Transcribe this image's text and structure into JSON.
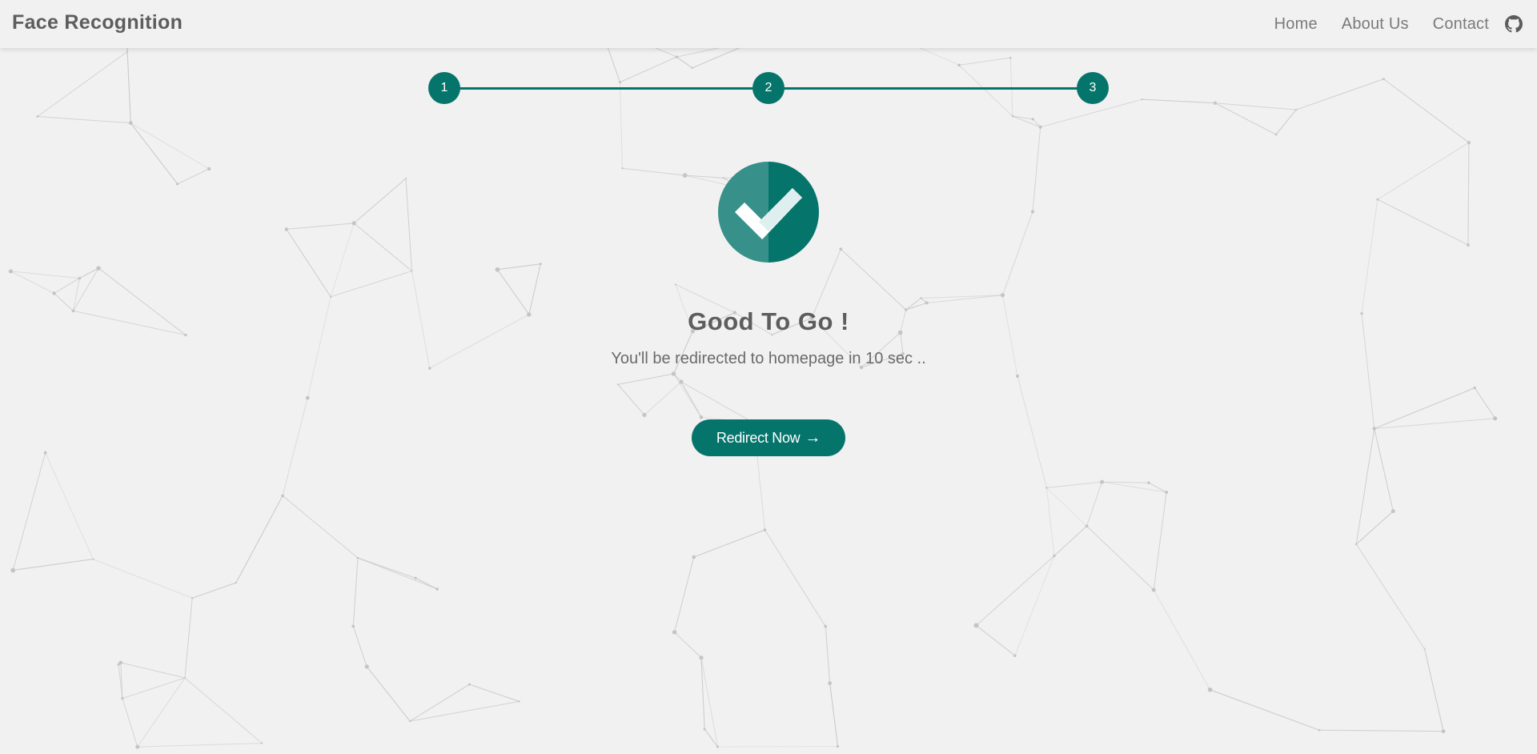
{
  "navbar": {
    "brand": "Face Recognition",
    "links": [
      "Home",
      "About Us",
      "Contact"
    ],
    "github_icon": "github-icon"
  },
  "stepper": {
    "steps": [
      "1",
      "2",
      "3"
    ],
    "current_step": 3
  },
  "status": {
    "icon": "check-circle-icon",
    "title": "Good To Go !",
    "message": "You'll be redirected to homepage in 10 sec .."
  },
  "action": {
    "button_label": "Redirect Now",
    "button_icon": "arrow-right-icon"
  },
  "colors": {
    "accent": "#05756c",
    "background": "#f1f1f1",
    "text": "#5d5d5d"
  }
}
